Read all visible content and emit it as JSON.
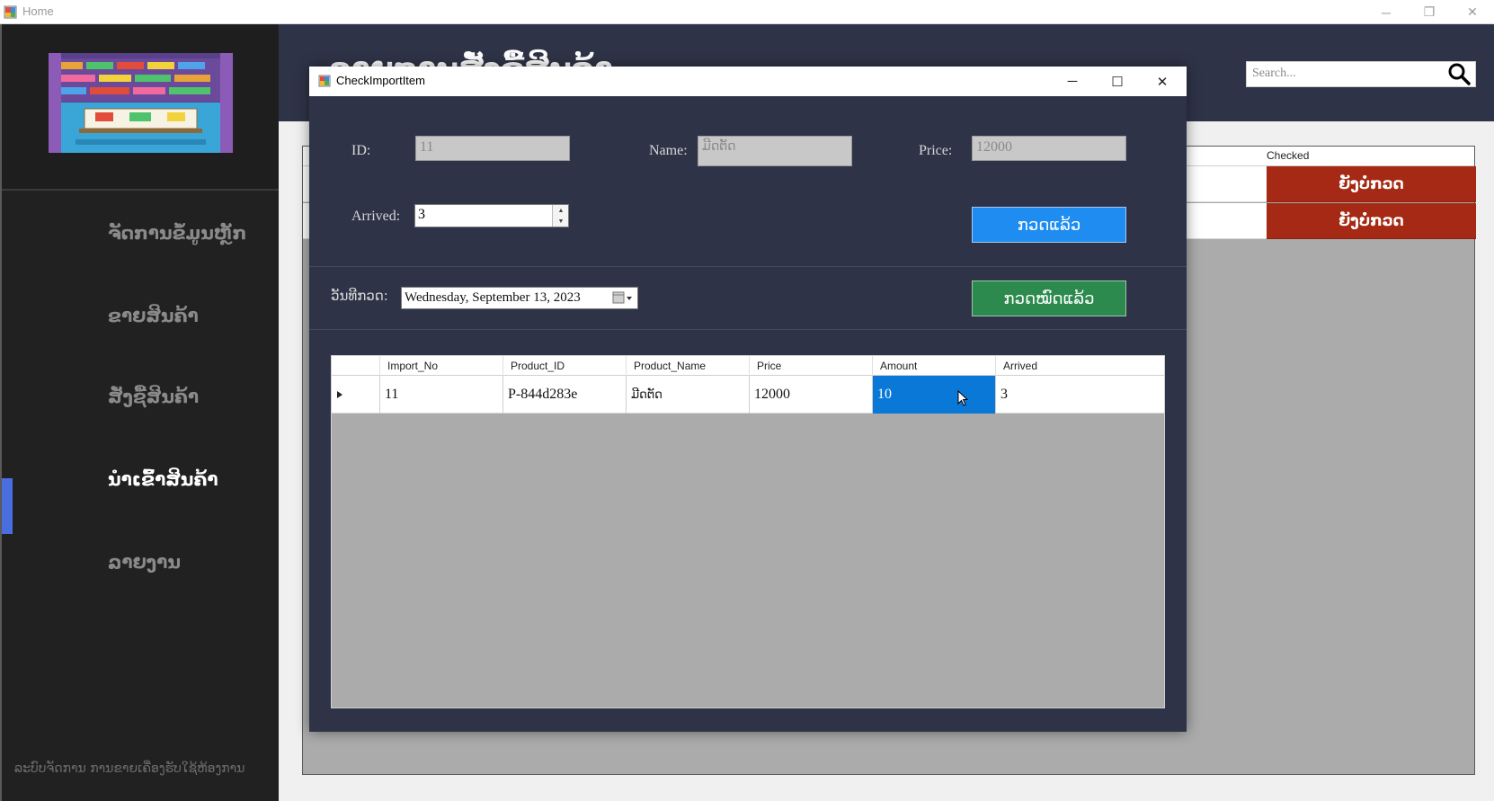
{
  "window": {
    "title": "Home",
    "controls": {
      "minimize": "─",
      "restore": "❐",
      "close": "✕"
    }
  },
  "sidebar": {
    "items": [
      {
        "label": "ຈັດການຂໍ້ມູນຫຼັກ",
        "active": false
      },
      {
        "label": "ຂາຍສິນຄ້າ",
        "active": false
      },
      {
        "label": "ສັ່ງຊື້ສິນຄ້າ",
        "active": false
      },
      {
        "label": "ນຳເຂົ້າສິນຄ້າ",
        "active": true
      },
      {
        "label": "ລາຍງານ",
        "active": false
      }
    ],
    "footer": "ລະບົບຈັດການ ການຂາຍເຄື່ອງຮັບໃຊ້ຫ້ອງການ"
  },
  "main": {
    "heading": "ລາຍການສັ່ງຊື້ສິນຄ້າ",
    "search": {
      "placeholder": "Search..."
    },
    "background_grid": {
      "checked_header": "Checked",
      "rows": [
        {
          "checked": "ຍັງບໍ່ກວດ"
        },
        {
          "checked": "ຍັງບໍ່ກວດ"
        }
      ]
    }
  },
  "dialog": {
    "title": "CheckImportItem",
    "controls": {
      "minimize": "─",
      "maximize": "☐",
      "close": "✕"
    },
    "fields": {
      "id_label": "ID:",
      "id_value": "11",
      "name_label": "Name:",
      "name_value": "ມີດຕັດ",
      "price_label": "Price:",
      "price_value": "12000",
      "arrived_label": "Arrived:",
      "arrived_value": "3",
      "date_label": "ວັນທີກວດ:",
      "date_value": "Wednesday, September 13, 2023"
    },
    "buttons": {
      "check": "ກວດແລ້ວ",
      "all_checked": "ກວດໝົດແລ້ວ"
    },
    "grid": {
      "columns": [
        "Import_No",
        "Product_ID",
        "Product_Name",
        "Price",
        "Amount",
        "Arrived"
      ],
      "rows": [
        {
          "Import_No": "11",
          "Product_ID": "P-844d283e",
          "Product_Name": "ມີດຕັດ",
          "Price": "12000",
          "Amount": "10",
          "Arrived": "3"
        }
      ],
      "selected_column": "Amount"
    }
  },
  "colors": {
    "sidebar_bg": "#212121",
    "header_bg": "#2e3347",
    "accent_blue": "#1e8cf0",
    "accent_green": "#2d8a4e",
    "status_red": "#a52914",
    "selection_blue": "#0a78d7"
  },
  "icons": [
    "app-icon",
    "search-icon",
    "calendar-icon",
    "row-pointer-icon",
    "mouse-cursor-icon",
    "shelf-logo"
  ]
}
